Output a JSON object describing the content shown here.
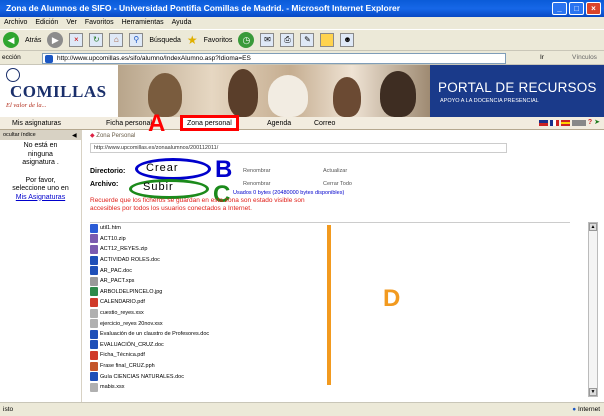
{
  "window": {
    "title": "Zona de Alumnos de SIFO - Universidad Pontifia Comillas de Madrid. - Microsoft Internet Explorer",
    "controls": [
      "_",
      "□",
      "×"
    ]
  },
  "menu": [
    "Archivo",
    "Edición",
    "Ver",
    "Favoritos",
    "Herramientas",
    "Ayuda"
  ],
  "toolbar": {
    "back_label": "Atrás",
    "search_label": "Búsqueda",
    "favorites_label": "Favoritos"
  },
  "address": {
    "label": "ección",
    "url": "http://www.upcomillas.es/sifo/alumno/IndexAlumno.asp?Idioma=ES",
    "go_label": "Ir",
    "links_label": "Vínculos"
  },
  "banner": {
    "logo_name": "COMILLAS",
    "logo_tagline": "El valor de la...",
    "portal_title": "PORTAL DE RECURSOS",
    "portal_subtitle": "APOYO A LA DOCENCIA PRESENCIAL"
  },
  "nav": {
    "tabs": [
      "Mis asignaturas",
      "Ficha personal",
      "Zona personal",
      "Agenda",
      "Correo"
    ],
    "active_tab": "Zona personal"
  },
  "sidebar": {
    "header": "ocultar índice",
    "message_lines": [
      "No está en",
      "ninguna",
      "asignatura ."
    ],
    "prompt_lines": [
      "Por favor,",
      "seleccione uno en"
    ],
    "link": "Mis Asignaturas"
  },
  "content": {
    "breadcrumb": "Zona Personal",
    "url": "http://www.upcomillas.es/zonaalumnos/200112011/",
    "directory_label": "Directorio:",
    "file_label": "Archivo:",
    "create_button": "Crear",
    "upload_button": "Subir",
    "rename_label": "Renombrar",
    "update_label": "Actualizar",
    "close_all_label": "Cerrar Todo",
    "quota_text": "Usados 0 bytes (20480000 bytes disponibles)",
    "warning_line1": "Recuerde que los ficheros se guardan en esta zona son estado visible son",
    "warning_line2": "accesibles por todos los usuarios conectados a Internet.",
    "files": [
      "util1.htm",
      "ACT10.zip",
      "ACT12_REYES.zip",
      "ACTIVIDAD ROLES.doc",
      "AR_PAC.doc",
      "AR_PACT.xps",
      "ARBOLDELPINCELO.jpg",
      "CALENDARIO.pdf",
      "cuestio_reyes.xsx",
      "ejercicio_reyes 20nov.xsx",
      "Evaluación de un claustro de Profesores.doc",
      "EVALUACIÓN_CRUZ.doc",
      "Ficha_Técnica.pdf",
      "Frase final_CRUZ.pph",
      "Guía CIENCIAS NATURALES.doc",
      "mabis.xsx"
    ]
  },
  "annotations": {
    "A": "A",
    "B": "B",
    "C": "C",
    "D": "D",
    "colors": {
      "red": "#ff0000",
      "blue": "#0000cc",
      "green": "#1b8a1b",
      "orange": "#f29a1f"
    }
  },
  "status": {
    "left": "isto",
    "zone": "Internet"
  }
}
